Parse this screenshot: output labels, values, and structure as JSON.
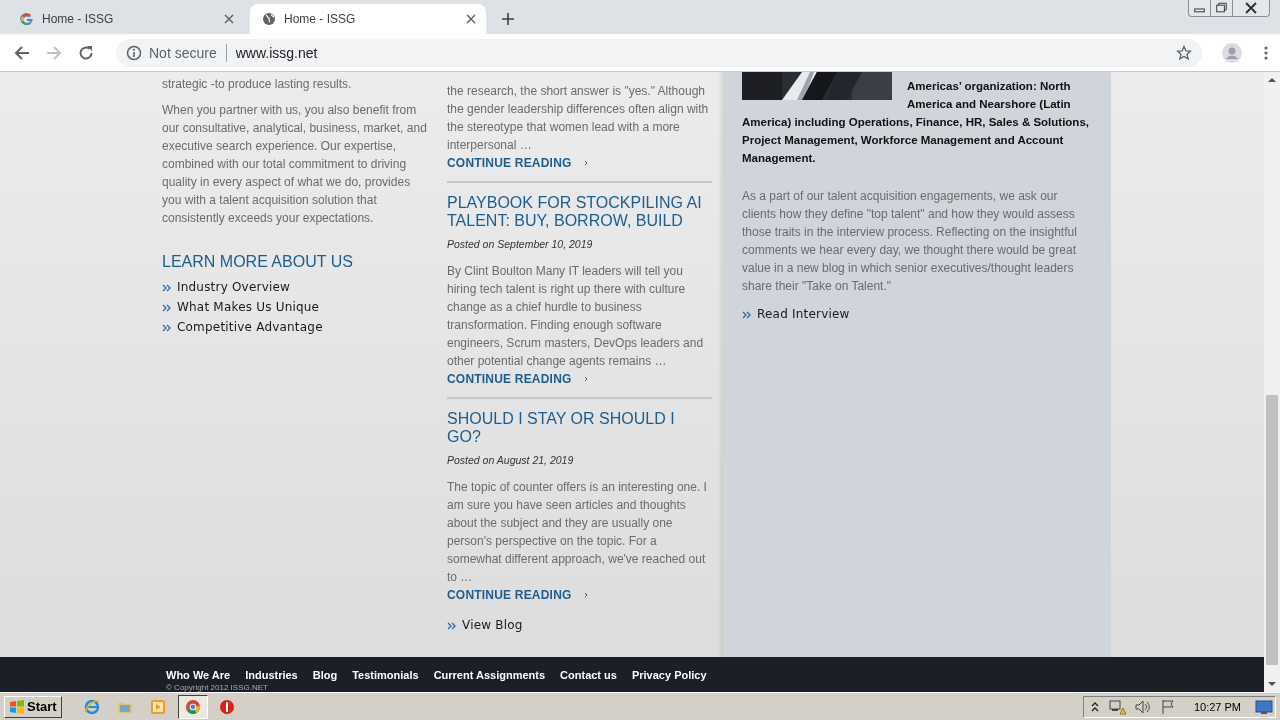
{
  "browser": {
    "tabs": [
      {
        "title": "Home - ISSG",
        "kind": "google",
        "selected": false
      },
      {
        "title": "Home - ISSG",
        "kind": "globe",
        "selected": true
      }
    ],
    "address": {
      "security": "Not secure",
      "url": "www.issg.net"
    }
  },
  "about": {
    "paragraphs": [
      "strategic -to produce lasting results.",
      "When you partner with us, you also benefit from our consultative, analytical, business, market, and executive search experience. Our expertise, combined with our total commitment to driving quality in every aspect of what we do, provides you with a talent acquisition solution that consistently exceeds your expectations."
    ],
    "heading": "LEARN MORE ABOUT US",
    "links": [
      "Industry Overview",
      "What Makes Us Unique",
      "Competitive Advantage"
    ]
  },
  "posts": [
    {
      "excerpt": "the research, the short answer is \"yes.\" Although the gender leadership differences often align with the stereotype that women lead with a more interpersonal …",
      "more": "CONTINUE READING"
    },
    {
      "title": "PLAYBOOK FOR STOCKPILING AI TALENT: BUY, BORROW, BUILD",
      "posted": "Posted on September 10, 2019",
      "excerpt": "By Clint Boulton Many IT leaders will tell you hiring tech talent is right up there with culture change as a chief hurdle to business transformation. Finding enough software engineers, Scrum masters, DevOps leaders and other potential change agents remains …",
      "more": "CONTINUE READING"
    },
    {
      "title": "SHOULD I STAY OR SHOULD I GO?",
      "posted": "Posted on August 21, 2019",
      "excerpt": "The topic of counter offers is an interesting one. I am sure you have seen articles and thoughts about the subject and they are usually one person's perspective on the topic. For a somewhat different approach, we've reached out to …",
      "more": "CONTINUE READING"
    }
  ],
  "view_blog": "View Blog",
  "feature": {
    "bio": [
      "Americas’ organization: North America and Nearshore (Latin",
      "America) including Operations, Finance, HR, Sales & Solutions, Project Management, Workforce Management and Account Management."
    ],
    "paragraph": "As a part of our talent acquisition engagements, we ask our clients how they define \"top talent\" and how they would assess those traits in the interview process. Reflecting on the insightful comments we hear every day, we thought there would be great value in a new blog in which senior executives/thought leaders share their \"Take on Talent.\"",
    "link": "Read Interview"
  },
  "footer": {
    "links": [
      "Who We Are",
      "Industries",
      "Blog",
      "Testimonials",
      "Current Assignments",
      "Contact us",
      "Privacy Policy"
    ],
    "copyright": "© Copyright 2012 ISSG.NET"
  },
  "taskbar": {
    "start": "Start",
    "apps": [
      {
        "kind": "ie",
        "selected": false
      },
      {
        "kind": "folder",
        "selected": false
      },
      {
        "kind": "media",
        "selected": false
      },
      {
        "kind": "chrome",
        "selected": true
      },
      {
        "kind": "stop",
        "selected": false
      }
    ],
    "clock": "10:27 PM"
  }
}
